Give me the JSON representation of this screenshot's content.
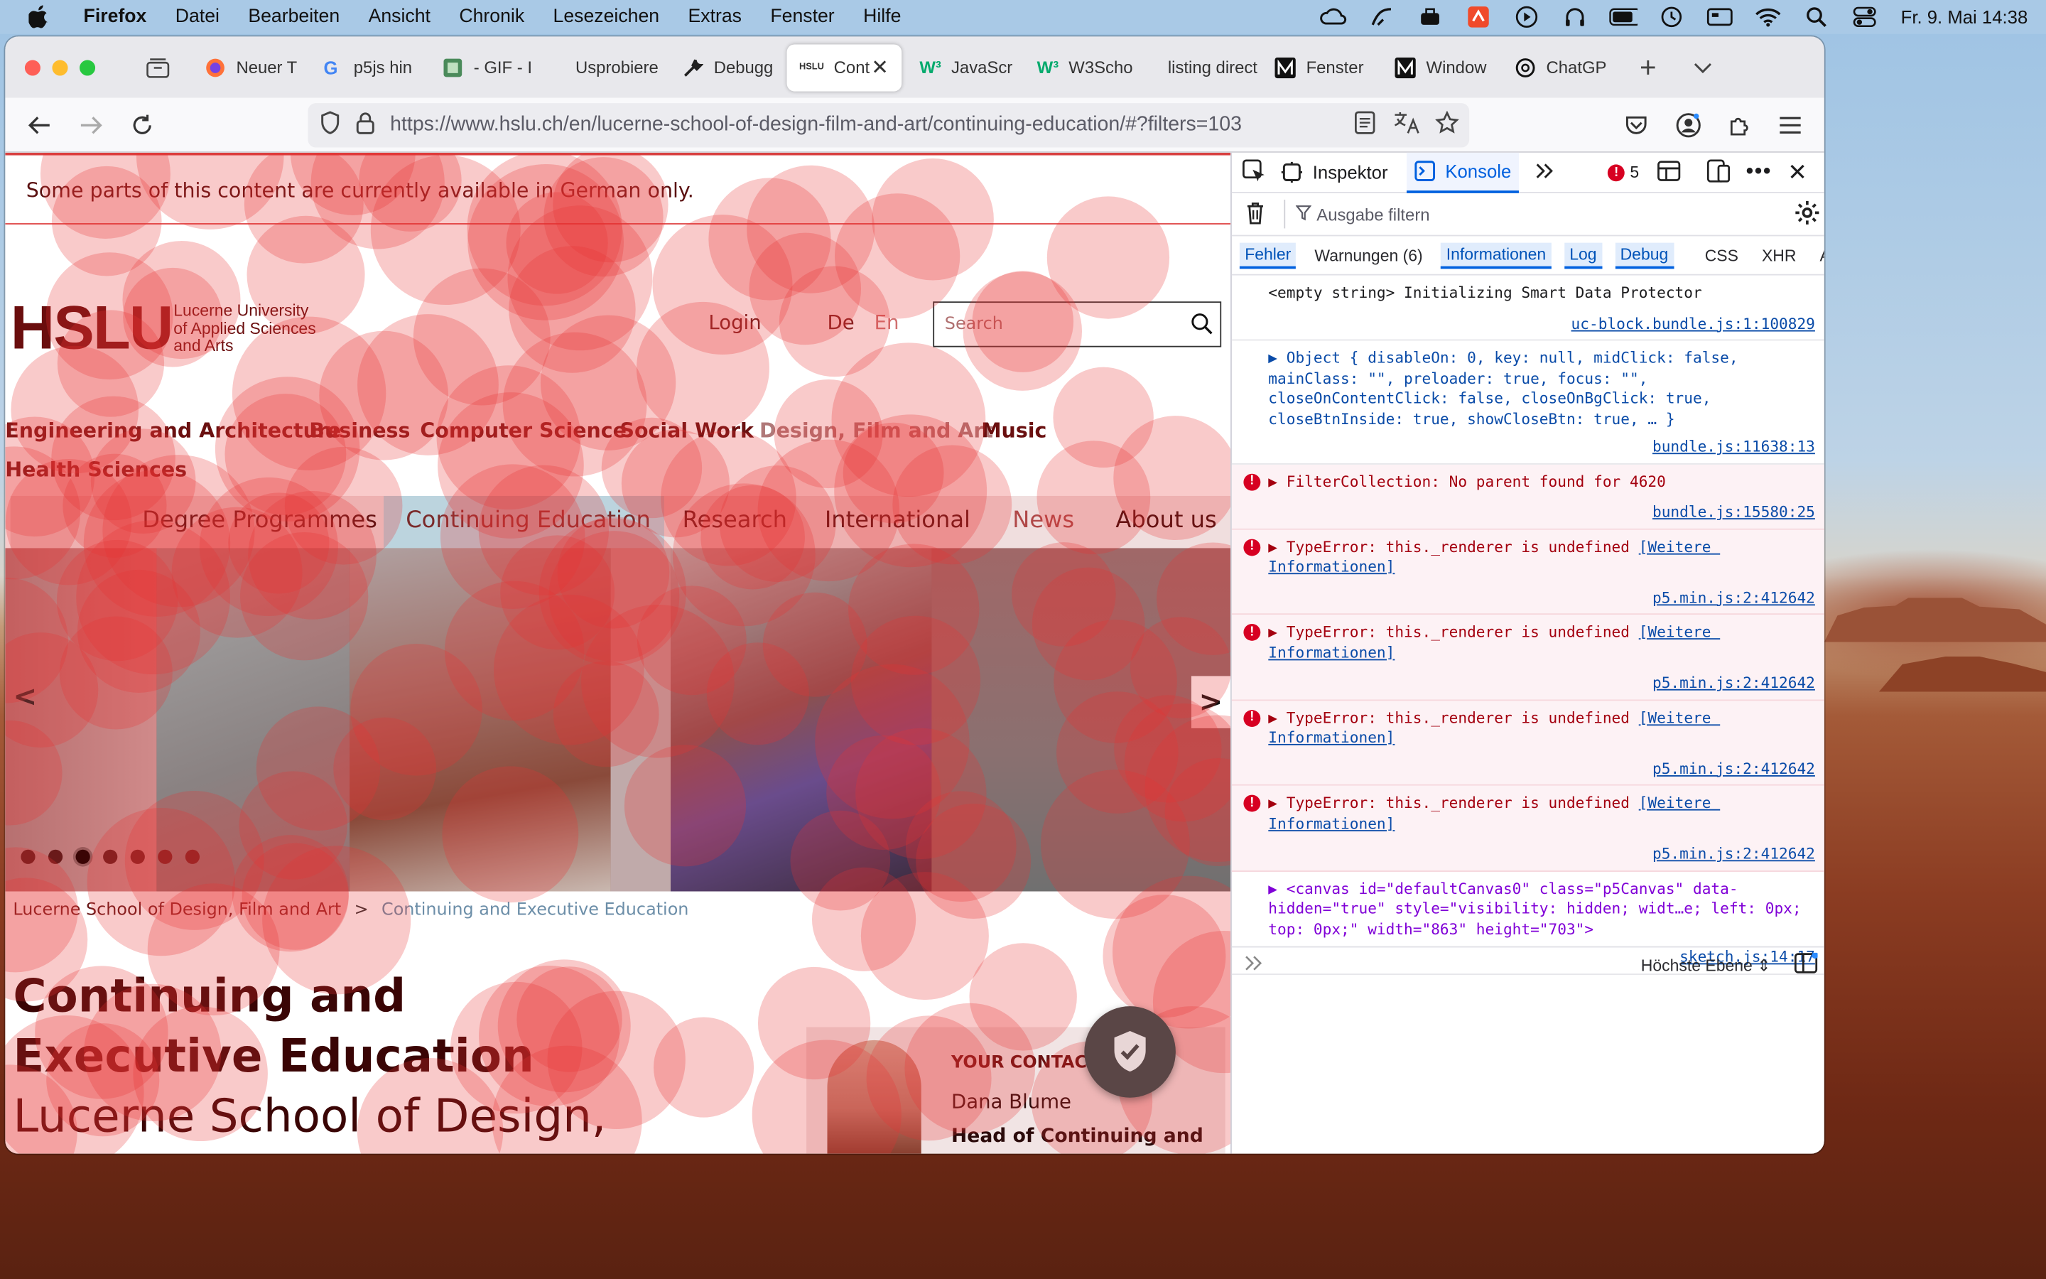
{
  "menubar": {
    "app": "Firefox",
    "items": [
      "Datei",
      "Bearbeiten",
      "Ansicht",
      "Chronik",
      "Lesezeichen",
      "Extras",
      "Fenster",
      "Hilfe"
    ],
    "clock": "Fr. 9. Mai  14:38"
  },
  "tabs": [
    {
      "label": "Neuer T",
      "icon": "firefox-icon"
    },
    {
      "label": "p5js hin",
      "icon": "google-icon"
    },
    {
      "label": "- GIF - I",
      "icon": "gif-icon"
    },
    {
      "label": "Usprobiere",
      "icon": ""
    },
    {
      "label": "Debugg",
      "icon": "wrench-icon"
    },
    {
      "label": "Cont",
      "icon": "hslu-icon",
      "active": true
    },
    {
      "label": "JavaScr",
      "icon": "w3schools-icon"
    },
    {
      "label": "W3Scho",
      "icon": "w3schools-icon"
    },
    {
      "label": "listing direct",
      "icon": ""
    },
    {
      "label": "Fenster",
      "icon": "m-icon"
    },
    {
      "label": "Window",
      "icon": "m-icon"
    },
    {
      "label": "ChatGP",
      "icon": "chatgpt-icon"
    }
  ],
  "hslu_fav": "HSLU",
  "url": "https://www.hslu.ch/en/lucerne-school-of-design-film-and-art/continuing-education/#?filters=103",
  "page": {
    "notice": "Some parts of this content are currently available in German only.",
    "logo": "HSLU",
    "logo_sub": [
      "Lucerne University",
      "of Applied Sciences",
      "and Arts"
    ],
    "login": "Login",
    "lang_de": "De",
    "lang_en": "En",
    "search_placeholder": "Search",
    "main_nav": [
      "Engineering and Architecture",
      "Business",
      "Computer Science",
      "Social Work",
      "Design, Film and Art",
      "Music",
      "Health Sciences"
    ],
    "sub_nav": [
      "Degree Programmes",
      "Continuing Education",
      "Research",
      "International",
      "News",
      "About us"
    ],
    "carousel_prev": "<",
    "carousel_next": ">",
    "breadcrumb": [
      "Lucerne School of Design, Film and Art",
      ">",
      "Continuing and Executive Education"
    ],
    "title_bold": "Continuing and Executive Education",
    "title_rest": " Lucerne School of Design, Film and Art",
    "contact_label": "YOUR CONTACT",
    "contact_name": "Dana Blume",
    "contact_role": "Head of Continuing and"
  },
  "devtools": {
    "tabs": {
      "inspector": "Inspektor",
      "console": "Konsole"
    },
    "error_count": "5",
    "filter_placeholder": "Ausgabe filtern",
    "categories": [
      "Fehler",
      "Warnungen (6)",
      "Informationen",
      "Log",
      "Debug",
      "CSS",
      "XHR",
      "Anfragen"
    ],
    "messages": [
      {
        "type": "log",
        "text": "<empty string> Initializing Smart Data Protector",
        "src": "uc-block.bundle.js:1:100829"
      },
      {
        "type": "log",
        "text": "▶ Object { disableOn: 0, key: null, midClick: false, mainClass: \"\", preloader: true, focus: \"\", closeOnContentClick: false, closeOnBgClick: true, closeBtnInside: true, showCloseBtn: true, … }",
        "src": "bundle.js:11638:13"
      },
      {
        "type": "error",
        "text": "▶ FilterCollection: No parent found for 4620",
        "src": "bundle.js:15580:25"
      },
      {
        "type": "error",
        "text": "▶ TypeError: this._renderer is undefined",
        "more": "[Weitere Informationen]",
        "src": "p5.min.js:2:412642"
      },
      {
        "type": "error",
        "text": "▶ TypeError: this._renderer is undefined",
        "more": "[Weitere Informationen]",
        "src": "p5.min.js:2:412642"
      },
      {
        "type": "error",
        "text": "▶ TypeError: this._renderer is undefined",
        "more": "[Weitere Informationen]",
        "src": "p5.min.js:2:412642"
      },
      {
        "type": "error",
        "text": "▶ TypeError: this._renderer is undefined",
        "more": "[Weitere Informationen]",
        "src": "p5.min.js:2:412642"
      },
      {
        "type": "log",
        "text": "▶ <canvas id=\"defaultCanvas0\" class=\"p5Canvas\" data-hidden=\"true\" style=\"visibility: hidden; widt…e; left: 0px; top: 0px;\" width=\"863\" height=\"703\">",
        "src": "sketch.js:14:17"
      }
    ],
    "prompt_context": "Höchste Ebene"
  },
  "colors": {
    "accent": "#0060df",
    "error": "#a4000f",
    "hslu_red": "#6a0d0d",
    "overlay": "#e83232"
  }
}
